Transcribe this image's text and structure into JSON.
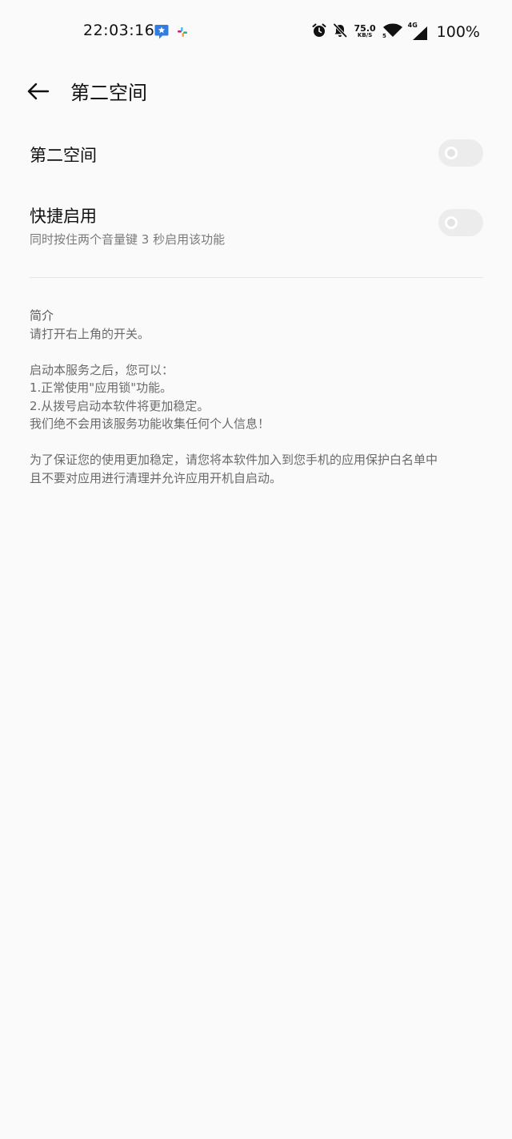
{
  "status_bar": {
    "time": "22:03:16",
    "net_speed_value": "75.0",
    "net_speed_unit": "KB/S",
    "network_type": "4G",
    "battery": "100%",
    "icons": [
      "app-notification-icon",
      "slack-icon",
      "alarm-icon",
      "bell-off-icon",
      "wifi-icon",
      "cell-signal-icon"
    ]
  },
  "app_bar": {
    "title": "第二空间"
  },
  "settings": [
    {
      "title": "第二空间",
      "enabled": false
    },
    {
      "title": "快捷启用",
      "subtitle": "同时按住两个音量键 3 秒启用该功能",
      "enabled": false
    }
  ],
  "intro": {
    "heading": "简介",
    "line_1": "请打开右上角的开关。",
    "line_2": "启动本服务之后，您可以：",
    "line_3": "1.正常使用\"应用锁\"功能。",
    "line_4": "2.从拨号启动本软件将更加稳定。",
    "line_5": "我们绝不会用该服务功能收集任何个人信息！",
    "line_6": "为了保证您的使用更加稳定，请您将本软件加入到您手机的应用保护白名单中",
    "line_7": "且不要对应用进行清理并允许应用开机自启动。"
  },
  "colors": {
    "background": "#fafafa",
    "toggle_off": "#ececec",
    "secondary_text": "#6a6a6a"
  }
}
